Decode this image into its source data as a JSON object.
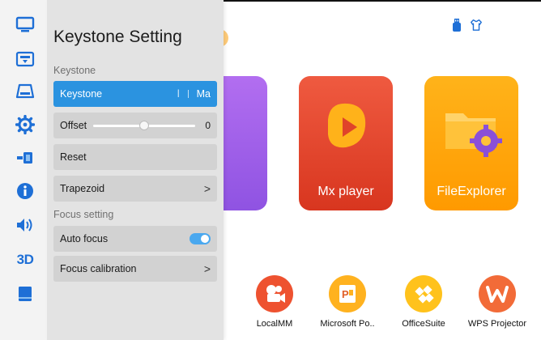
{
  "panel": {
    "title": "Keystone Setting",
    "sections": {
      "keystone_label": "Keystone",
      "focus_label": "Focus setting"
    },
    "keystone_row": {
      "label": "Keystone",
      "mode_left": "l",
      "mode_right": "Ma"
    },
    "offset_row": {
      "label": "Offset",
      "value": "0",
      "slider_fraction": 0.5
    },
    "reset_row": {
      "label": "Reset"
    },
    "trapezoid_row": {
      "label": "Trapezoid",
      "chevron": ">"
    },
    "auto_focus_row": {
      "label": "Auto focus",
      "enabled": true
    },
    "focus_calibration_row": {
      "label": "Focus calibration",
      "chevron": ">"
    }
  },
  "rail": {
    "items": [
      "display-icon",
      "projector-icon",
      "input-source-icon",
      "settings-gear-icon",
      "connect-icon",
      "info-icon",
      "volume-icon",
      "3d-icon",
      "book-icon"
    ],
    "three_d_label": "3D"
  },
  "home": {
    "tiles": [
      {
        "name": "purple-app",
        "label": ""
      },
      {
        "name": "mx-player",
        "label": "Mx player"
      },
      {
        "name": "file-explorer",
        "label": "FileExplorer"
      }
    ],
    "dock": [
      {
        "label": "LocalMM"
      },
      {
        "label": "Microsoft Po.."
      },
      {
        "label": "OfficeSuite"
      },
      {
        "label": "WPS Projector"
      }
    ],
    "status_icons": [
      "usb-icon",
      "shirt-icon"
    ]
  },
  "colors": {
    "accent_blue": "#2b93e0",
    "rail_icon_blue": "#1e6fd6",
    "mx_red": "#e0432a",
    "file_orange": "#ffa500",
    "purple": "#9c5ee8"
  }
}
